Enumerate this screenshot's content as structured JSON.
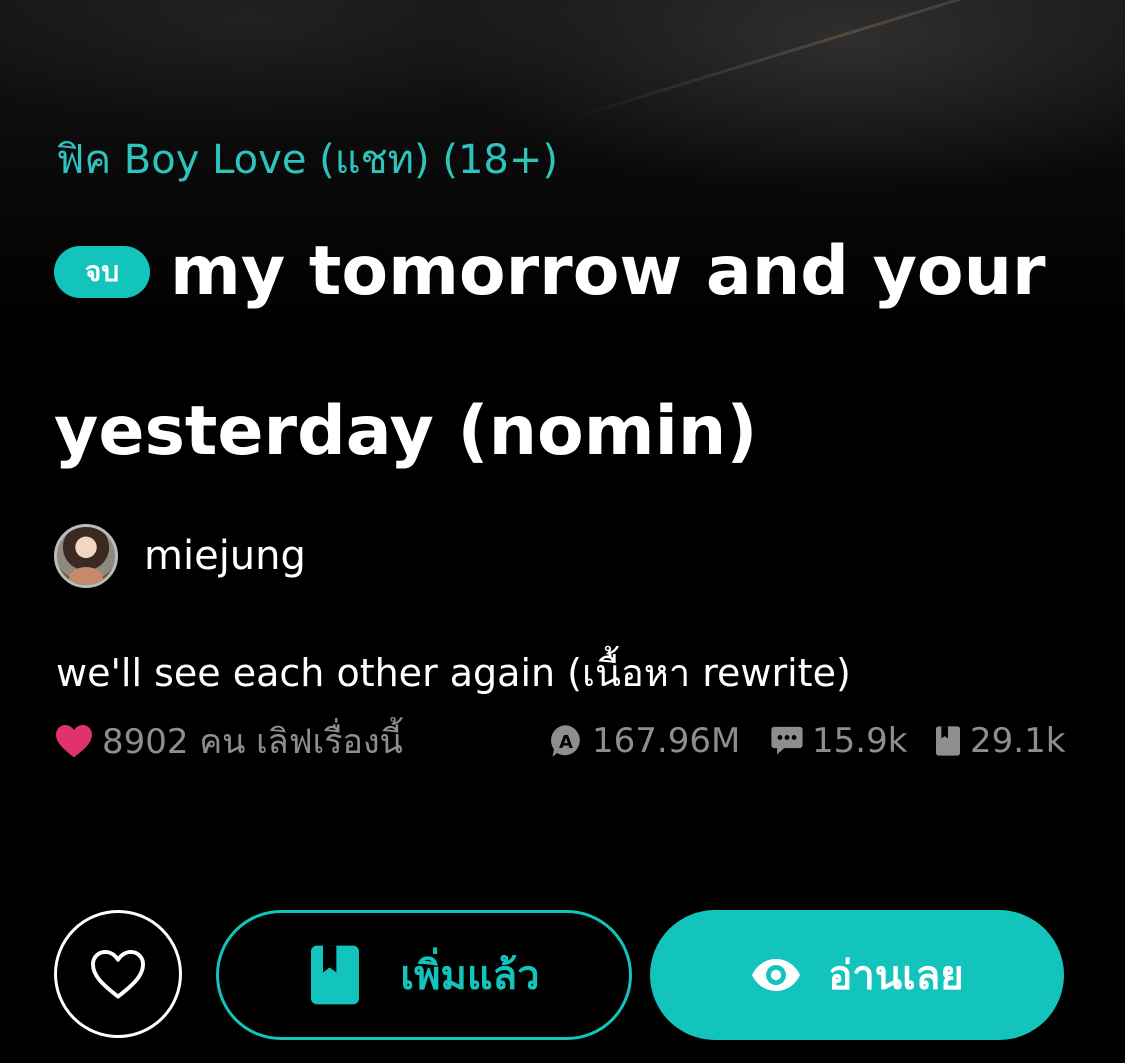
{
  "story": {
    "category": "ฟิค Boy Love (แชท) (18+)",
    "status_badge": "จบ",
    "title_line1": "my tomorrow and your",
    "title_line2": "yesterday (nomin)",
    "author": "miejung",
    "description": "we'll see each other again (เนื้อหา rewrite)"
  },
  "stats": {
    "loves_text": "8902 คน เลิฟเรื่องนี้",
    "views": "167.96M",
    "comments": "15.9k",
    "bookmarks": "29.1k"
  },
  "icons": {
    "heart_stat": "heart-icon",
    "views": "views-badge-icon",
    "comments": "comment-icon",
    "bookmarks": "book-icon",
    "favorite": "heart-outline-icon",
    "added": "bookmark-book-icon",
    "read": "eye-icon"
  },
  "actions": {
    "added_label": "เพิ่มแล้ว",
    "read_label": "อ่านเลย"
  },
  "colors": {
    "accent": "#13c4bd",
    "heart": "#e0336b",
    "muted": "#8e8e8e",
    "background": "#000000"
  }
}
